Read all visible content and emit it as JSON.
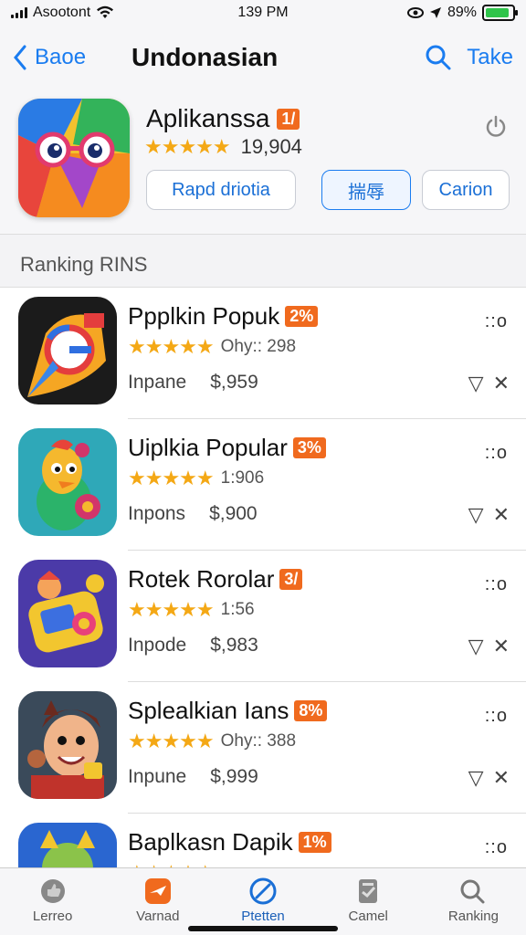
{
  "status": {
    "carrier": "Asootont",
    "time": "139 PM",
    "battery": "89%",
    "battery_level": 0.89
  },
  "nav": {
    "back_label": "Baoe",
    "title": "Undonasian",
    "action_label": "Take"
  },
  "featured": {
    "name": "Aplikanssa",
    "badge": "1/",
    "rating_count": "19,904",
    "pill_left": "Rapd driotia",
    "pill_mid": "揣辱",
    "pill_right": "Carion"
  },
  "section": {
    "title": "Ranking RINS"
  },
  "apps": [
    {
      "name": "Ppplkin Popuk",
      "badge": "2%",
      "rating": "Ohy:: 298",
      "category": "Inpane",
      "price": "$,959",
      "dots": "::o"
    },
    {
      "name": "Uiplkia Popular",
      "badge": "3%",
      "rating": "1:906",
      "category": "Inpons",
      "price": "$,900",
      "dots": "::o"
    },
    {
      "name": "Rotek Rorolar",
      "badge": "3/",
      "rating": "1:56",
      "category": "Inpode",
      "price": "$,983",
      "dots": "::o"
    },
    {
      "name": "Splealkian Ians",
      "badge": "8%",
      "rating": "Ohy:: 388",
      "category": "Inpune",
      "price": "$,999",
      "dots": "::o"
    },
    {
      "name": "Baplkasn Dapik",
      "badge": "1%",
      "rating": "",
      "category": "",
      "price": "",
      "dots": "::o"
    }
  ],
  "tabs": [
    {
      "label": "Lerreo",
      "icon": "thumb-icon"
    },
    {
      "label": "Varnad",
      "icon": "plane-icon"
    },
    {
      "label": "Ptetten",
      "icon": "compass-icon"
    },
    {
      "label": "Camel",
      "icon": "clipboard-icon"
    },
    {
      "label": "Ranking",
      "icon": "search-icon"
    }
  ],
  "colors": {
    "accent": "#1a7cf0",
    "badge": "#f06a1e",
    "star": "#f4a815"
  }
}
